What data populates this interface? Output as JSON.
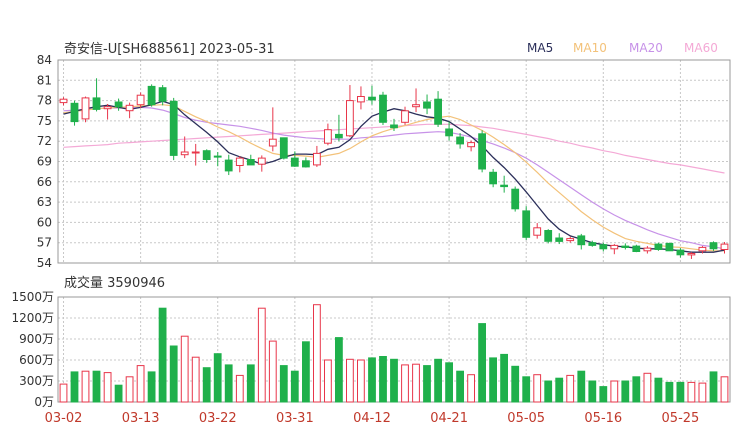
{
  "header": {
    "title": "奇安信-U[SH688561] 2023-05-31"
  },
  "legend": [
    {
      "label": "MA5",
      "color": "#2b2f5a"
    },
    {
      "label": "MA10",
      "color": "#f3c27a"
    },
    {
      "label": "MA20",
      "color": "#c792e8"
    },
    {
      "label": "MA60",
      "color": "#f4a9d6"
    }
  ],
  "volume_panel": {
    "title": "成交量 3590946"
  },
  "colors": {
    "up": "#e8364a",
    "down": "#1fb04b",
    "grid": "#c8c8c8",
    "axis": "#333333",
    "date": "#c0392b"
  },
  "chart_data": [
    {
      "type": "candlestick",
      "title": "",
      "dates": [
        "03-02",
        "03-03",
        "03-06",
        "03-07",
        "03-08",
        "03-09",
        "03-10",
        "03-13",
        "03-14",
        "03-15",
        "03-16",
        "03-17",
        "03-20",
        "03-21",
        "03-22",
        "03-23",
        "03-24",
        "03-27",
        "03-28",
        "03-29",
        "03-30",
        "03-31",
        "04-03",
        "04-04",
        "04-06",
        "04-07",
        "04-10",
        "04-11",
        "04-12",
        "04-13",
        "04-14",
        "04-17",
        "04-18",
        "04-19",
        "04-20",
        "04-21",
        "04-24",
        "04-25",
        "04-26",
        "04-27",
        "04-28",
        "05-04",
        "05-05",
        "05-08",
        "05-09",
        "05-10",
        "05-11",
        "05-12",
        "05-15",
        "05-16",
        "05-17",
        "05-18",
        "05-19",
        "05-22",
        "05-23",
        "05-24",
        "05-25",
        "05-26",
        "05-29",
        "05-30",
        "05-31"
      ],
      "x_tick_labels": [
        "03-02",
        "03-13",
        "03-22",
        "03-31",
        "04-12",
        "04-21",
        "05-05",
        "05-16",
        "05-25"
      ],
      "x_tick_index": [
        0,
        7,
        14,
        21,
        28,
        35,
        42,
        49,
        56
      ],
      "ylim": [
        54,
        84
      ],
      "y_ticks": [
        "84",
        "81",
        "78",
        "75",
        "72",
        "69",
        "66",
        "63",
        "60",
        "57",
        "54"
      ],
      "ohlc": [
        [
          77.7,
          78.5,
          77.3,
          78.2
        ],
        [
          77.6,
          78.0,
          74.3,
          74.9
        ],
        [
          75.3,
          78.6,
          74.8,
          78.4
        ],
        [
          78.4,
          81.3,
          76.4,
          76.7
        ],
        [
          76.8,
          77.5,
          75.2,
          77.1
        ],
        [
          77.8,
          78.3,
          76.5,
          77.1
        ],
        [
          76.5,
          77.7,
          75.4,
          77.3
        ],
        [
          77.4,
          79.2,
          76.9,
          78.8
        ],
        [
          80.1,
          80.4,
          77.1,
          77.4
        ],
        [
          79.9,
          80.3,
          77.3,
          77.9
        ],
        [
          77.9,
          78.4,
          69.2,
          69.9
        ],
        [
          70.0,
          72.7,
          69.5,
          70.4
        ],
        [
          70.4,
          71.6,
          68.4,
          70.4
        ],
        [
          70.6,
          70.8,
          68.8,
          69.3
        ],
        [
          69.8,
          70.4,
          68.3,
          69.7
        ],
        [
          69.2,
          70.0,
          67.0,
          67.6
        ],
        [
          68.4,
          69.8,
          67.4,
          69.5
        ],
        [
          69.3,
          70.0,
          68.5,
          68.5
        ],
        [
          68.6,
          69.9,
          67.5,
          69.5
        ],
        [
          71.3,
          77.0,
          70.5,
          72.3
        ],
        [
          72.5,
          72.5,
          69.3,
          69.5
        ],
        [
          69.5,
          70.5,
          68.2,
          68.3
        ],
        [
          69.1,
          69.6,
          68.1,
          68.2
        ],
        [
          68.5,
          71.3,
          68.2,
          70.2
        ],
        [
          71.7,
          74.6,
          71.4,
          73.7
        ],
        [
          73.0,
          75.9,
          72.0,
          72.5
        ],
        [
          72.8,
          80.3,
          72.6,
          78.0
        ],
        [
          77.8,
          80.1,
          76.7,
          78.6
        ],
        [
          78.5,
          80.2,
          77.4,
          78.1
        ],
        [
          78.8,
          79.3,
          74.4,
          74.8
        ],
        [
          74.4,
          75.3,
          73.5,
          74.0
        ],
        [
          74.8,
          77.1,
          74.4,
          76.5
        ],
        [
          77.1,
          79.8,
          76.3,
          77.4
        ],
        [
          77.8,
          78.9,
          76.0,
          76.9
        ],
        [
          78.2,
          79.4,
          74.1,
          74.5
        ],
        [
          73.8,
          74.9,
          72.1,
          72.8
        ],
        [
          72.6,
          73.2,
          70.9,
          71.6
        ],
        [
          71.2,
          72.1,
          70.5,
          71.8
        ],
        [
          73.1,
          73.6,
          67.4,
          67.9
        ],
        [
          67.4,
          67.9,
          65.2,
          65.7
        ],
        [
          65.5,
          66.9,
          64.4,
          65.3
        ],
        [
          64.9,
          65.3,
          61.6,
          62.0
        ],
        [
          61.7,
          62.4,
          57.4,
          57.8
        ],
        [
          58.1,
          59.9,
          57.6,
          59.2
        ],
        [
          58.8,
          59.0,
          56.9,
          57.2
        ],
        [
          57.7,
          58.4,
          56.8,
          57.2
        ],
        [
          57.3,
          57.9,
          57.0,
          57.6
        ],
        [
          58.0,
          58.3,
          56.0,
          56.7
        ],
        [
          57.0,
          57.3,
          56.4,
          56.6
        ],
        [
          56.7,
          57.0,
          55.7,
          56.1
        ],
        [
          56.1,
          56.8,
          55.3,
          56.6
        ],
        [
          56.5,
          56.9,
          56.0,
          56.3
        ],
        [
          56.5,
          56.7,
          55.6,
          55.7
        ],
        [
          55.8,
          56.5,
          55.4,
          56.2
        ],
        [
          56.8,
          57.0,
          55.8,
          56.0
        ],
        [
          56.9,
          57.0,
          55.8,
          55.8
        ],
        [
          55.9,
          56.2,
          54.8,
          55.2
        ],
        [
          55.2,
          55.6,
          54.6,
          55.4
        ],
        [
          55.8,
          56.5,
          55.4,
          56.3
        ],
        [
          57.0,
          57.2,
          55.8,
          56.1
        ],
        [
          56.0,
          57.1,
          55.4,
          56.8
        ]
      ],
      "ma": {
        "MA5": [
          76.0,
          76.4,
          76.8,
          77.1,
          77.3,
          77.0,
          76.7,
          77.0,
          77.4,
          77.9,
          77.4,
          75.9,
          74.6,
          73.3,
          71.9,
          70.3,
          69.7,
          69.2,
          68.6,
          69.0,
          69.6,
          70.1,
          70.1,
          70.0,
          70.8,
          71.1,
          72.2,
          74.2,
          75.7,
          76.3,
          76.8,
          76.5,
          76.0,
          75.6,
          75.4,
          74.9,
          73.8,
          72.7,
          71.3,
          69.6,
          68.1,
          66.4,
          64.5,
          62.5,
          60.5,
          59.0,
          58.0,
          57.5,
          57.0,
          56.7,
          56.5,
          56.4,
          56.2,
          56.1,
          56.1,
          56.0,
          55.8,
          55.6,
          55.6,
          55.6,
          55.9
        ],
        "MA10": [
          76.2,
          76.4,
          76.6,
          76.8,
          76.9,
          77.0,
          77.1,
          77.2,
          77.3,
          77.4,
          77.2,
          76.4,
          75.6,
          74.9,
          74.1,
          73.4,
          72.6,
          71.7,
          70.9,
          70.2,
          69.9,
          69.9,
          69.8,
          69.6,
          69.9,
          70.2,
          70.9,
          71.9,
          72.8,
          73.4,
          73.9,
          74.3,
          74.8,
          75.2,
          75.5,
          75.7,
          75.2,
          74.4,
          73.6,
          72.6,
          71.5,
          70.3,
          68.9,
          67.4,
          65.8,
          64.4,
          63.0,
          61.6,
          60.4,
          59.3,
          58.4,
          57.6,
          57.2,
          56.9,
          56.6,
          56.4,
          56.3,
          56.1,
          55.9,
          55.8,
          55.8
        ],
        "MA20": [
          76.5,
          76.6,
          76.7,
          76.8,
          76.9,
          76.9,
          77.0,
          77.0,
          76.9,
          76.6,
          76.1,
          75.5,
          75.1,
          74.8,
          74.6,
          74.4,
          74.2,
          73.9,
          73.6,
          73.2,
          72.9,
          72.7,
          72.5,
          72.4,
          72.3,
          72.3,
          72.3,
          72.5,
          72.6,
          72.7,
          72.9,
          73.1,
          73.2,
          73.3,
          73.4,
          73.3,
          73.0,
          72.6,
          72.1,
          71.6,
          71.0,
          70.3,
          69.5,
          68.5,
          67.4,
          66.3,
          65.2,
          64.1,
          63.0,
          62.0,
          61.1,
          60.3,
          59.6,
          58.9,
          58.3,
          57.8,
          57.3,
          57.0,
          56.6,
          56.4,
          56.1
        ],
        "MA60": [
          71.1,
          71.2,
          71.3,
          71.4,
          71.5,
          71.7,
          71.8,
          71.9,
          72.0,
          72.1,
          72.2,
          72.3,
          72.4,
          72.5,
          72.6,
          72.7,
          72.8,
          72.9,
          73.0,
          73.1,
          73.2,
          73.3,
          73.4,
          73.5,
          73.6,
          73.7,
          73.8,
          73.9,
          74.0,
          74.1,
          74.2,
          74.3,
          74.4,
          74.5,
          74.5,
          74.5,
          74.4,
          74.3,
          74.1,
          73.9,
          73.6,
          73.3,
          73.0,
          72.7,
          72.4,
          72.0,
          71.7,
          71.3,
          71.0,
          70.6,
          70.3,
          69.9,
          69.6,
          69.3,
          69.0,
          68.7,
          68.5,
          68.2,
          67.9,
          67.6,
          67.3
        ]
      }
    },
    {
      "type": "bar",
      "title": "成交量",
      "ylim": [
        0,
        1500
      ],
      "y_ticks": [
        "1500万",
        "1200万",
        "900万",
        "600万",
        "300万",
        "0万"
      ],
      "y_tick_values": [
        1500,
        1200,
        900,
        600,
        300,
        0
      ],
      "values": [
        255,
        430,
        440,
        440,
        420,
        240,
        360,
        520,
        430,
        1340,
        800,
        940,
        640,
        490,
        690,
        530,
        380,
        530,
        1340,
        870,
        520,
        440,
        860,
        1390,
        600,
        920,
        610,
        600,
        630,
        650,
        610,
        530,
        540,
        520,
        610,
        560,
        440,
        390,
        1120,
        630,
        680,
        510,
        360,
        390,
        300,
        340,
        380,
        440,
        300,
        220,
        300,
        300,
        360,
        410,
        340,
        280,
        280,
        280,
        270,
        430,
        360
      ]
    }
  ]
}
